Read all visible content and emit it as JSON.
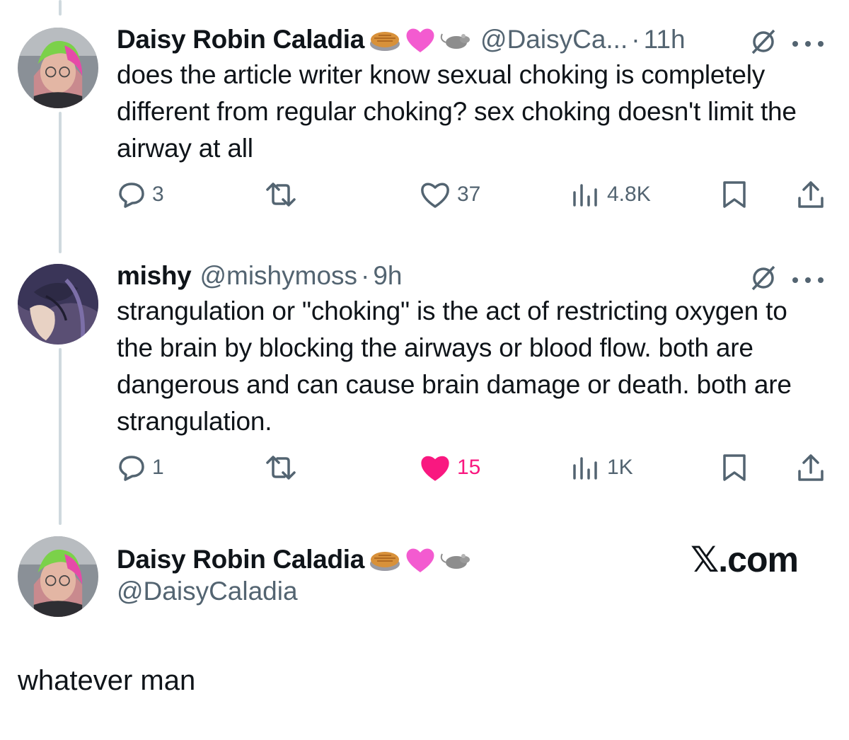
{
  "tweets": [
    {
      "name": "Daisy Robin Caladia",
      "handle": "@DaisyCa...",
      "dot": "·",
      "time": "11h",
      "text": "does the article writer know sexual choking is completely different from regular choking? sex choking doesn't limit the airway at all",
      "stats": {
        "replies": "3",
        "retweets": "",
        "likes": "37",
        "views": "4.8K"
      },
      "liked": false
    },
    {
      "name": "mishy",
      "handle": "@mishymoss",
      "dot": "·",
      "time": "9h",
      "text": "strangulation or \"choking\" is the act of restricting oxygen to the brain by blocking the airways or blood flow. both are dangerous and can cause brain damage or death. both are strangulation.",
      "stats": {
        "replies": "1",
        "retweets": "",
        "likes": "15",
        "views": "1K"
      },
      "liked": true
    }
  ],
  "quote_card": {
    "name": "Daisy Robin Caladia",
    "handle": "@DaisyCaladia",
    "brand": "𝕏.com"
  },
  "caption": "whatever man",
  "icons": {
    "name_emojis": [
      "pie-emoji",
      "pink-heart-emoji",
      "rat-emoji"
    ],
    "actions": [
      "reply-icon",
      "retweet-icon",
      "like-icon",
      "views-icon",
      "bookmark-icon",
      "share-icon"
    ],
    "top_right": [
      "grok-icon",
      "more-icon"
    ]
  },
  "colors": {
    "text": "#0f1419",
    "muted": "#536471",
    "like_active": "#f91880",
    "thread_line": "#cfd9de"
  }
}
